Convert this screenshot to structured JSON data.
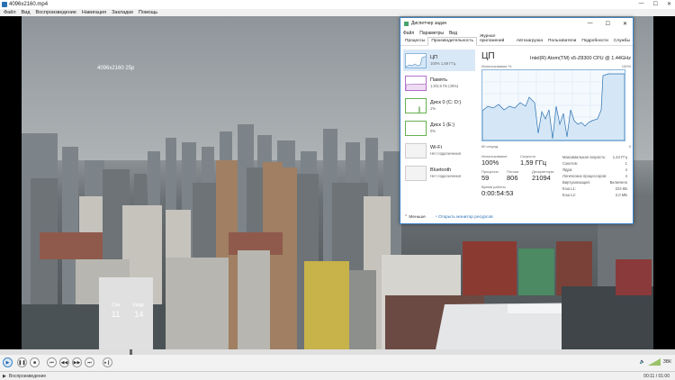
{
  "window": {
    "title": "4096x2160.mp4",
    "controls": [
      "—",
      "☐",
      "✕"
    ]
  },
  "menu": [
    "Файл",
    "Вид",
    "Воспроизведение",
    "Навигация",
    "Закладки",
    "Помощь"
  ],
  "video": {
    "resolution_osd": "4096x2160 25p",
    "stats": {
      "labels": [
        "Сек",
        "Кадр"
      ],
      "values": [
        "11",
        "14"
      ]
    }
  },
  "task_manager": {
    "title": "Диспетчер задач",
    "menu": [
      "Файл",
      "Параметры",
      "Вид"
    ],
    "tabs": [
      "Процессы",
      "Производительность",
      "Журнал приложений",
      "Автозагрузка",
      "Пользователи",
      "Подробности",
      "Службы"
    ],
    "active_tab": "Производительность",
    "side_items": [
      {
        "name": "ЦП",
        "sub": "100% 1,59 ГГц"
      },
      {
        "name": "Память",
        "sub": "1,9/3,9 ГБ (49%)"
      },
      {
        "name": "Диск 0 (C: D:)",
        "sub": "1%"
      },
      {
        "name": "Диск 1 (E:)",
        "sub": "0%"
      },
      {
        "name": "Wi-Fi",
        "sub": "Нет подключения"
      },
      {
        "name": "Bluetooth",
        "sub": "Нет подключения"
      }
    ],
    "cpu": {
      "heading": "ЦП",
      "model": "Intel(R) Atom(TM) x5-Z8300 CPU @ 1.44GHz",
      "graph_top_left": "Использование %",
      "graph_top_right": "100%",
      "graph_bottom_left": "60 секунд",
      "graph_bottom_right": "0",
      "usage_label": "Использование",
      "usage_value": "100%",
      "speed_label": "Скорость",
      "speed_value": "1,59 ГГц",
      "processes_label": "Процессы",
      "processes_value": "59",
      "threads_label": "Потоки",
      "threads_value": "806",
      "handles_label": "Дескрипторы",
      "handles_value": "21094",
      "uptime_label": "Время работы",
      "uptime_value": "0:00:54:53",
      "specs": [
        {
          "k": "Максимальная скорость:",
          "v": "1,44 ГГц"
        },
        {
          "k": "Сокетов:",
          "v": "1"
        },
        {
          "k": "Ядра:",
          "v": "4"
        },
        {
          "k": "Логических процессоров:",
          "v": "4"
        },
        {
          "k": "Виртуализация:",
          "v": "Включено"
        },
        {
          "k": "Кэш L1:",
          "v": "224 КБ"
        },
        {
          "k": "Кэш L2:",
          "v": "2,0 МБ"
        }
      ]
    },
    "footer": {
      "less": "Меньше",
      "monitor": "Открыть монитор ресурсов"
    }
  },
  "player": {
    "status": "Воспроизведение",
    "time": "00:11 / 01:00",
    "volume_label": "ЗВК",
    "buttons": [
      "play",
      "pause",
      "stop",
      "prev",
      "rewind",
      "forward",
      "next",
      "frame"
    ]
  }
}
